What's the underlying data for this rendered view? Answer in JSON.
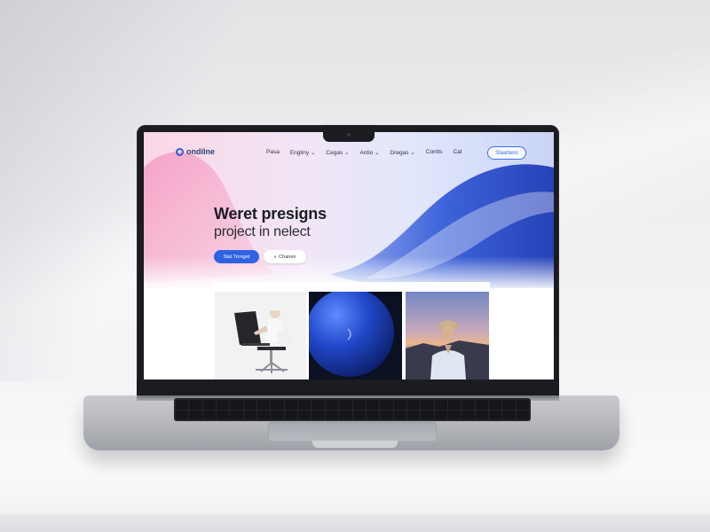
{
  "website": {
    "logo_text": "ondilne",
    "nav": {
      "links": [
        "Pasa",
        "Engliny ⌄",
        "Cegas ⌄",
        "Antio ⌄",
        "Dregas ⌄",
        "Contts",
        "Cal"
      ],
      "cta_label": "Slaarteno"
    },
    "hero": {
      "title": "Weret presigns",
      "subtitle": "project in nelect",
      "primary_button": "Slat Tronget",
      "secondary_button": "Chanes"
    },
    "gallery": {
      "items": [
        {
          "subject": "person-at-laptop-chair"
        },
        {
          "subject": "blue-sphere"
        },
        {
          "subject": "person-in-hat-portrait"
        }
      ]
    }
  },
  "colors": {
    "accent": "#2f63e3",
    "logo": "#2d5ddb",
    "wave_blue": "#2f52c7",
    "wave_pink": "#f7a9c7"
  }
}
